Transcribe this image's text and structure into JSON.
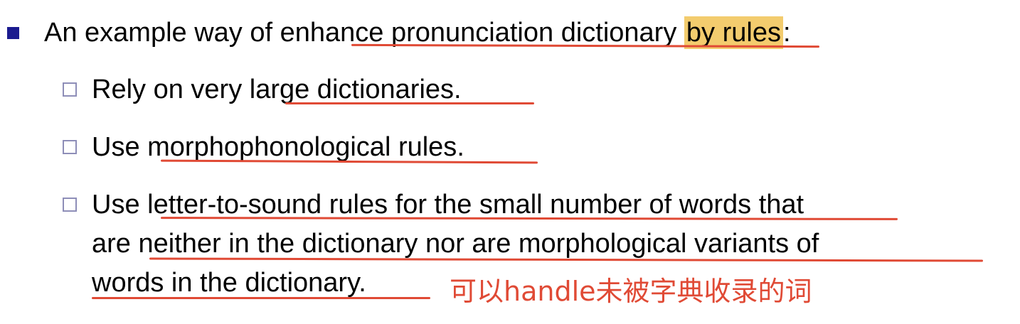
{
  "bullet_main": {
    "prefix": "An example way of e",
    "underlined": "nhance pronunciation dictionary",
    "space": " ",
    "highlight": "by rules",
    "suffix": ":"
  },
  "sub1": {
    "prefix": "Rely on very ",
    "underlined": "large dictionaries",
    "suffix": "."
  },
  "sub2": {
    "prefix": "Use ",
    "underlined": "morphophonological rules",
    "suffix": "."
  },
  "sub3": {
    "line1_prefix": "Use ",
    "line1_underlined": "letter-to-sound rules for the small number of words",
    "line1_suffix": " that",
    "line2_prefix": "are ",
    "line2_underlined": "neither in the dictionary nor are morphological variants of",
    "line3_underlined": "words in the dictionary."
  },
  "annotation": "可以handle未被字典收录的词",
  "colors": {
    "annotation_red": "#e04a35",
    "highlight_yellow": "#f3cc6e",
    "bullet_navy": "#1b1b8f"
  }
}
